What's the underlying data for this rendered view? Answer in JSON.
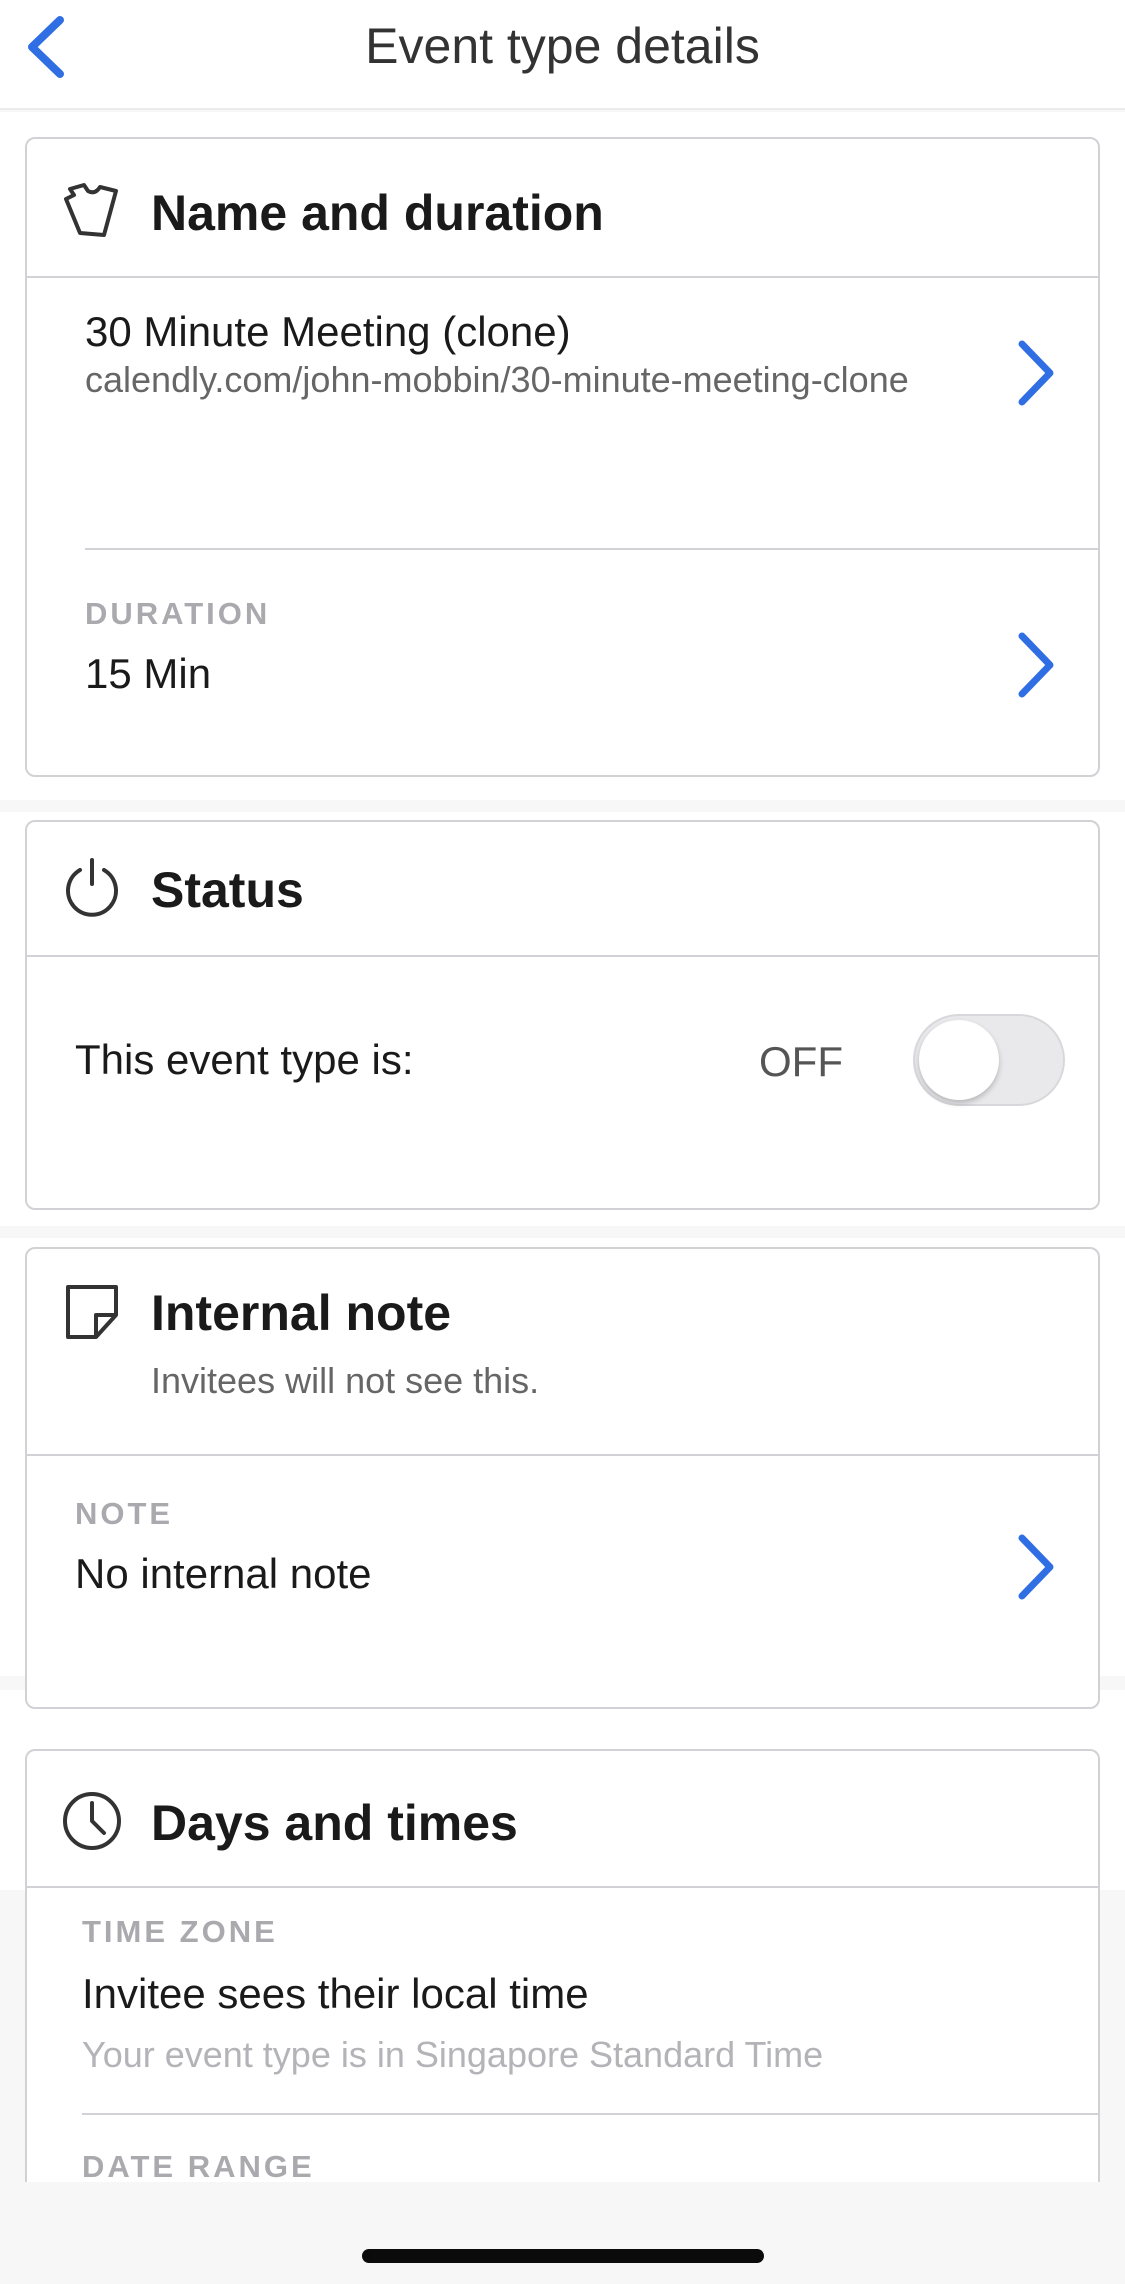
{
  "header": {
    "back_icon": "chevron-left-icon",
    "title": "Event type details"
  },
  "name_duration": {
    "icon": "ticket-icon",
    "title": "Name and duration",
    "event_name": "30 Minute Meeting (clone)",
    "event_url": "calendly.com/john-mobbin/30-minute-meeting-clone",
    "duration_label": "DURATION",
    "duration_value": "15 Min"
  },
  "status": {
    "icon": "power-icon",
    "title": "Status",
    "label": "This event type is:",
    "state_text": "OFF",
    "enabled": false
  },
  "internal_note": {
    "icon": "sticky-note-icon",
    "title": "Internal note",
    "subtitle": "Invitees will not see this.",
    "note_label": "NOTE",
    "note_value": "No internal note"
  },
  "days_times": {
    "icon": "clock-icon",
    "title": "Days and times",
    "time_zone_label": "TIME ZONE",
    "time_zone_value": "Invitee sees their local time",
    "time_zone_detail": "Your event type is in Singapore Standard Time",
    "date_range_label": "DATE RANGE"
  },
  "colors": {
    "accent_blue": "#2f6ee3",
    "border_gray": "#d2d2d6",
    "label_gray": "#a9a9ae"
  }
}
